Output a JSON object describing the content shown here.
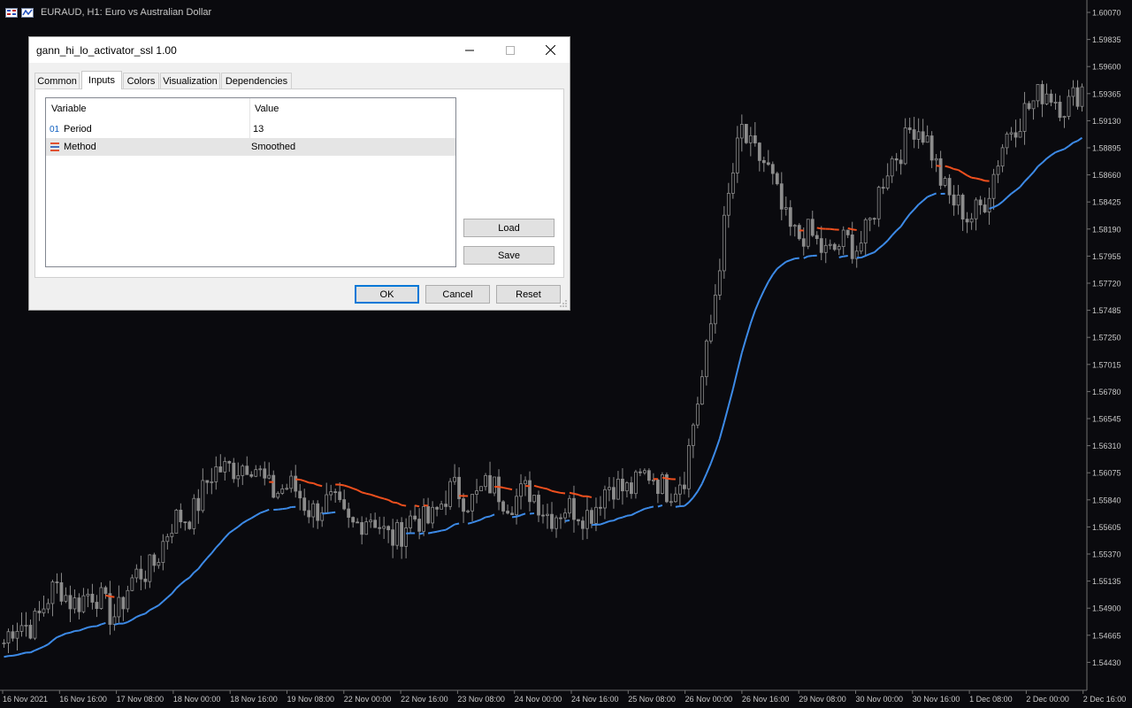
{
  "chart": {
    "symbol_line": "EURAUD, H1:  Euro vs Australian Dollar",
    "background": "#0a0a0e",
    "candle_color": "#8c8c8c",
    "ssl_up_color": "#3d8be8",
    "ssl_down_color": "#f0501e",
    "price_labels": [
      "1.60070",
      "1.59835",
      "1.59600",
      "1.59365",
      "1.59130",
      "1.58895",
      "1.58660",
      "1.58425",
      "1.58190",
      "1.57955",
      "1.57720",
      "1.57485",
      "1.57250",
      "1.57015",
      "1.56780",
      "1.56545",
      "1.56310",
      "1.56075",
      "1.55840",
      "1.55605",
      "1.55370",
      "1.55135",
      "1.54900",
      "1.54665",
      "1.54430"
    ],
    "time_labels": [
      "16 Nov 2021",
      "16 Nov 16:00",
      "17 Nov 08:00",
      "18 Nov 00:00",
      "18 Nov 16:00",
      "19 Nov 08:00",
      "22 Nov 00:00",
      "22 Nov 16:00",
      "23 Nov 08:00",
      "24 Nov 00:00",
      "24 Nov 16:00",
      "25 Nov 08:00",
      "26 Nov 00:00",
      "26 Nov 16:00",
      "29 Nov 08:00",
      "30 Nov 00:00",
      "30 Nov 16:00",
      "1 Dec 08:00",
      "2 Dec 00:00",
      "2 Dec 16:00"
    ]
  },
  "dialog": {
    "title": "gann_hi_lo_activator_ssl 1.00",
    "tabs": [
      "Common",
      "Inputs",
      "Colors",
      "Visualization",
      "Dependencies"
    ],
    "active_tab": "Inputs",
    "table": {
      "columns": [
        "Variable",
        "Value"
      ],
      "rows": [
        {
          "icon": "01",
          "variable": "Period",
          "value": "13"
        },
        {
          "icon": "enum-icon",
          "variable": "Method",
          "value": "Smoothed"
        }
      ]
    },
    "side_buttons": {
      "load": "Load",
      "save": "Save"
    },
    "buttons": {
      "ok": "OK",
      "cancel": "Cancel",
      "reset": "Reset"
    }
  },
  "chart_data": {
    "type": "line",
    "title": "EURAUD, H1:  Euro vs Australian Dollar",
    "ylim": [
      1.5432,
      1.6018
    ],
    "x": [
      "16 Nov 2021",
      "16 Nov 16:00",
      "17 Nov 08:00",
      "18 Nov 00:00",
      "18 Nov 16:00",
      "19 Nov 08:00",
      "22 Nov 00:00",
      "22 Nov 16:00",
      "23 Nov 08:00",
      "24 Nov 00:00",
      "24 Nov 16:00",
      "25 Nov 08:00",
      "26 Nov 00:00",
      "26 Nov 16:00",
      "29 Nov 08:00",
      "30 Nov 00:00",
      "30 Nov 16:00",
      "1 Dec 08:00",
      "2 Dec 00:00",
      "2 Dec 16:00"
    ],
    "series": [
      {
        "values": [
          1.546,
          1.5505,
          1.549,
          1.556,
          1.562,
          1.559,
          1.557,
          1.5555,
          1.559,
          1.559,
          1.557,
          1.56,
          1.56,
          1.591,
          1.581,
          1.58,
          1.5915,
          1.582,
          1.593,
          1.5935
        ]
      }
    ]
  }
}
